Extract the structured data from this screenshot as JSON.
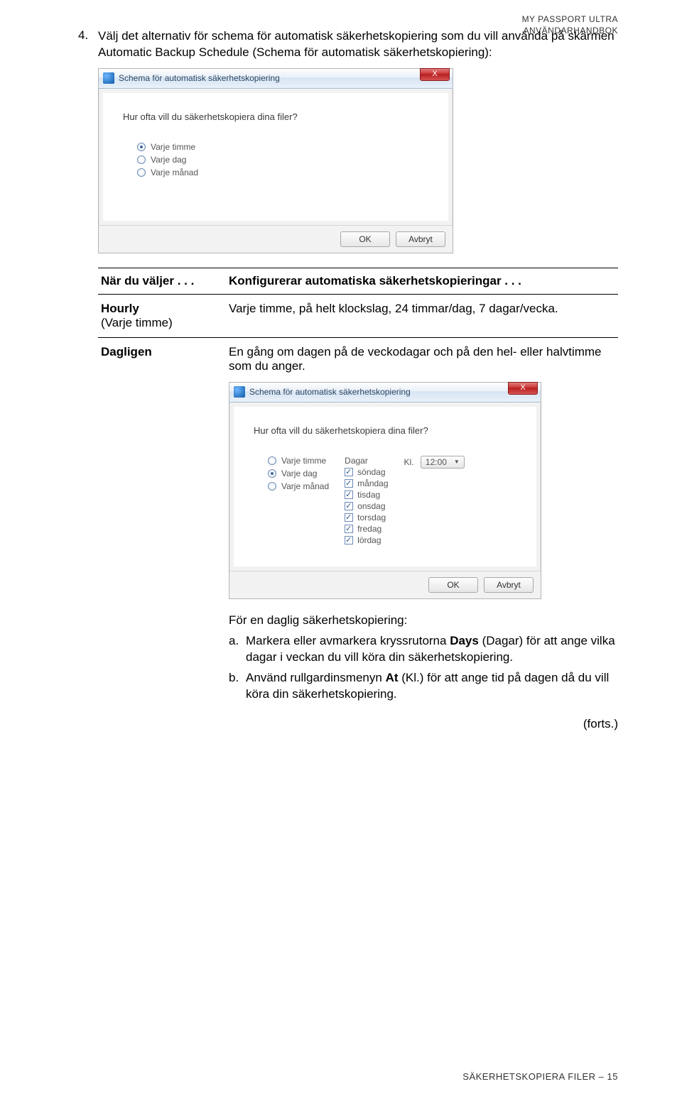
{
  "header": {
    "line1": "MY PASSPORT ULTRA",
    "line2": "ANVÄNDARHANDBOK"
  },
  "step": {
    "number": "4.",
    "text": "Välj det alternativ för schema för automatisk säkerhetskopiering som du vill använda på skärmen Automatic Backup Schedule (Schema för automatisk säkerhetskopiering):"
  },
  "dialog1": {
    "title": "Schema för automatisk säkerhetskopiering",
    "close": "X",
    "question": "Hur ofta vill du säkerhetskopiera dina filer?",
    "options": [
      {
        "label": "Varje timme",
        "checked": true
      },
      {
        "label": "Varje dag",
        "checked": false
      },
      {
        "label": "Varje månad",
        "checked": false
      }
    ],
    "ok": "OK",
    "cancel": "Avbryt"
  },
  "table": {
    "h1": "När du väljer . . .",
    "h2": "Konfigurerar automatiska säkerhetskopieringar . . .",
    "row1_c1a": "Hourly",
    "row1_c1b": "(Varje timme)",
    "row1_c2": "Varje timme, på helt klockslag, 24 timmar/dag, 7 dagar/vecka.",
    "row2_c1": "Dagligen",
    "row2_c2": "En gång om dagen på de veckodagar och på den hel- eller halvtimme som du anger."
  },
  "dialog2": {
    "title": "Schema för automatisk säkerhetskopiering",
    "close": "X",
    "question": "Hur ofta vill du säkerhetskopiera dina filer?",
    "options": [
      {
        "label": "Varje timme",
        "checked": false
      },
      {
        "label": "Varje dag",
        "checked": true
      },
      {
        "label": "Varje månad",
        "checked": false
      }
    ],
    "days_header": "Dagar",
    "days": [
      {
        "label": "söndag",
        "checked": true
      },
      {
        "label": "måndag",
        "checked": true
      },
      {
        "label": "tisdag",
        "checked": true
      },
      {
        "label": "onsdag",
        "checked": true
      },
      {
        "label": "torsdag",
        "checked": true
      },
      {
        "label": "fredag",
        "checked": true
      },
      {
        "label": "lördag",
        "checked": true
      }
    ],
    "time_label": "Kl.",
    "time_value": "12:00",
    "ok": "OK",
    "cancel": "Avbryt"
  },
  "daily_intro": "För en daglig säkerhetskopiering:",
  "sub_a_letter": "a.",
  "sub_a_pre": "Markera eller avmarkera kryssrutorna ",
  "sub_a_bold": "Days",
  "sub_a_post": " (Dagar) för att ange vilka dagar i veckan du vill köra din säkerhetskopiering.",
  "sub_b_letter": "b.",
  "sub_b_pre": "Använd rullgardinsmenyn ",
  "sub_b_bold": "At",
  "sub_b_post": " (Kl.) för att ange tid på dagen då du vill köra din säkerhetskopiering.",
  "cont": "(forts.)",
  "footer": "SÄKERHETSKOPIERA FILER – 15"
}
